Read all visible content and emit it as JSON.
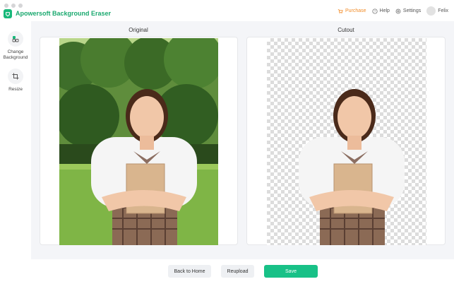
{
  "app": {
    "title": "Apowersoft Background Eraser",
    "brand_color": "#18b87a"
  },
  "header": {
    "purchase": "Purchase",
    "help": "Help",
    "settings": "Settings",
    "user": "Felix"
  },
  "sidebar": {
    "items": [
      {
        "label": "Change\nBackground",
        "icon": "change-background-icon"
      },
      {
        "label": "Resize",
        "icon": "crop-icon"
      }
    ]
  },
  "main": {
    "original_title": "Original",
    "cutout_title": "Cutout"
  },
  "footer": {
    "back_label": "Back to Home",
    "reupload_label": "Reupload",
    "save_label": "Save"
  }
}
